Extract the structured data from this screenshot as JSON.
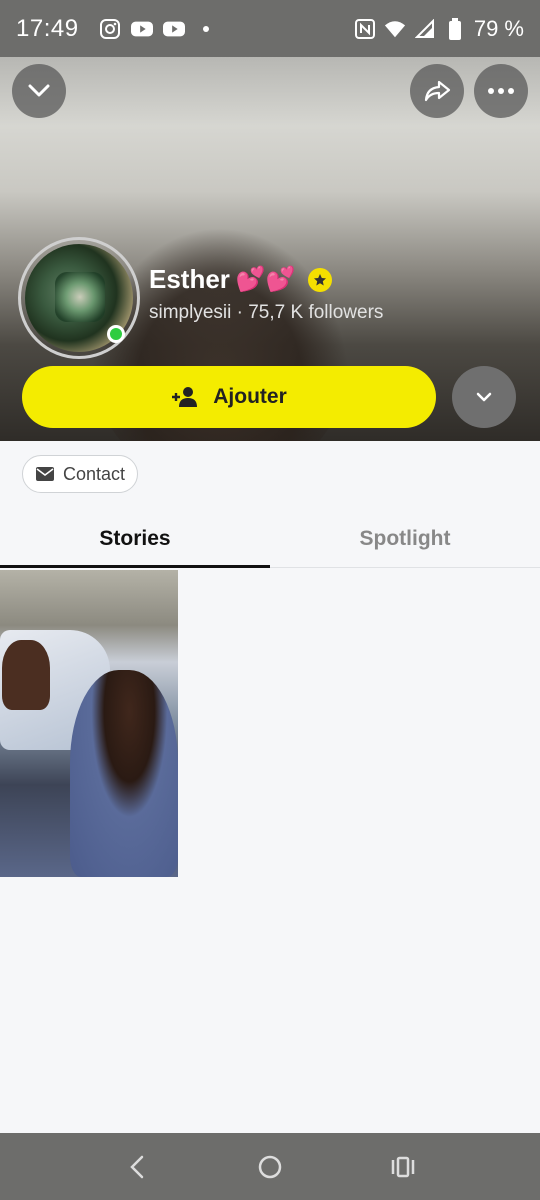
{
  "status_bar": {
    "time": "17:49",
    "battery": "79 %",
    "left_icons": [
      "instagram-icon",
      "youtube-icon",
      "youtube-icon",
      "dot-icon"
    ],
    "right_icons": [
      "nfc-icon",
      "wifi-icon",
      "signal-icon",
      "battery-icon"
    ]
  },
  "profile": {
    "name": "Esther",
    "name_emoji": "💕💕",
    "subline": "simplyesii · 75,7 K followers",
    "online": true
  },
  "actions": {
    "add_label": "Ajouter",
    "contact_label": "Contact"
  },
  "tabs": [
    {
      "label": "Stories",
      "active": true
    },
    {
      "label": "Spotlight",
      "active": false
    }
  ],
  "colors": {
    "accent_yellow": "#f4ec00",
    "online_green": "#2ecc40",
    "status_bar": "#6d6d6b"
  }
}
